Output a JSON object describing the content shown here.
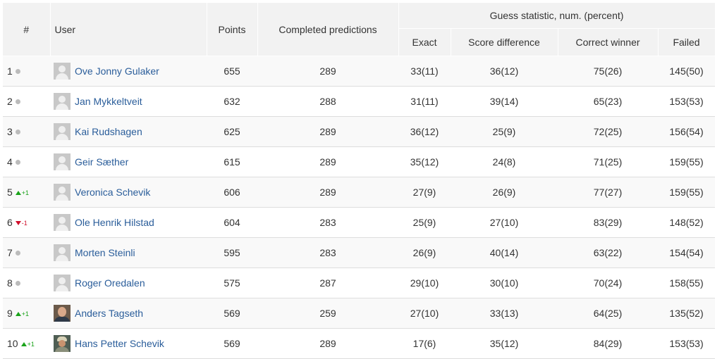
{
  "header": {
    "rank": "#",
    "user": "User",
    "points": "Points",
    "completed": "Completed predictions",
    "guess_group": "Guess statistic, num. (percent)",
    "exact": "Exact",
    "score_difference": "Score difference",
    "correct_winner": "Correct winner",
    "failed": "Failed"
  },
  "colors": {
    "link": "#2a5d9a",
    "up": "#1aa31a",
    "down": "#d0102c",
    "neutral_dot": "#bbbbbb"
  },
  "rows": [
    {
      "rank": "1",
      "move": "",
      "dir": "same",
      "avatar": "placeholder",
      "name": "Ove Jonny Gulaker",
      "points": "655",
      "completed": "289",
      "exact": "33(11)",
      "score_diff": "36(12)",
      "winner": "75(26)",
      "failed": "145(50)"
    },
    {
      "rank": "2",
      "move": "",
      "dir": "same",
      "avatar": "placeholder",
      "name": "Jan Mykkeltveit",
      "points": "632",
      "completed": "288",
      "exact": "31(11)",
      "score_diff": "39(14)",
      "winner": "65(23)",
      "failed": "153(53)"
    },
    {
      "rank": "3",
      "move": "",
      "dir": "same",
      "avatar": "placeholder",
      "name": "Kai Rudshagen",
      "points": "625",
      "completed": "289",
      "exact": "36(12)",
      "score_diff": "25(9)",
      "winner": "72(25)",
      "failed": "156(54)"
    },
    {
      "rank": "4",
      "move": "",
      "dir": "same",
      "avatar": "placeholder",
      "name": "Geir Sæther",
      "points": "615",
      "completed": "289",
      "exact": "35(12)",
      "score_diff": "24(8)",
      "winner": "71(25)",
      "failed": "159(55)"
    },
    {
      "rank": "5",
      "move": "+1",
      "dir": "up",
      "avatar": "placeholder",
      "name": "Veronica Schevik",
      "points": "606",
      "completed": "289",
      "exact": "27(9)",
      "score_diff": "26(9)",
      "winner": "77(27)",
      "failed": "159(55)"
    },
    {
      "rank": "6",
      "move": "-1",
      "dir": "down",
      "avatar": "placeholder",
      "name": "Ole Henrik Hilstad",
      "points": "604",
      "completed": "283",
      "exact": "25(9)",
      "score_diff": "27(10)",
      "winner": "83(29)",
      "failed": "148(52)"
    },
    {
      "rank": "7",
      "move": "",
      "dir": "same",
      "avatar": "placeholder",
      "name": "Morten Steinli",
      "points": "595",
      "completed": "283",
      "exact": "26(9)",
      "score_diff": "40(14)",
      "winner": "63(22)",
      "failed": "154(54)"
    },
    {
      "rank": "8",
      "move": "",
      "dir": "same",
      "avatar": "placeholder",
      "name": "Roger Oredalen",
      "points": "575",
      "completed": "287",
      "exact": "29(10)",
      "score_diff": "30(10)",
      "winner": "70(24)",
      "failed": "158(55)"
    },
    {
      "rank": "9",
      "move": "+1",
      "dir": "up",
      "avatar": "photo1",
      "name": "Anders Tagseth",
      "points": "569",
      "completed": "259",
      "exact": "27(10)",
      "score_diff": "33(13)",
      "winner": "64(25)",
      "failed": "135(52)"
    },
    {
      "rank": "10",
      "move": "+1",
      "dir": "up",
      "avatar": "photo2",
      "name": "Hans Petter Schevik",
      "points": "569",
      "completed": "289",
      "exact": "17(6)",
      "score_diff": "35(12)",
      "winner": "84(29)",
      "failed": "153(53)"
    }
  ]
}
